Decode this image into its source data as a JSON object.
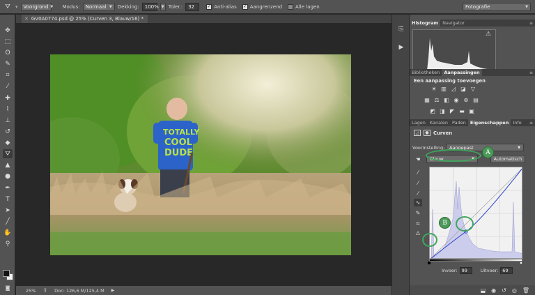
{
  "options_bar": {
    "fill_mode": "Voorgrond",
    "mode_label": "Modus:",
    "mode_value": "Normaal",
    "opacity_label": "Dekking:",
    "opacity_value": "100%",
    "tolerance_label": "Toler.:",
    "tolerance_value": "32",
    "antialias_label": "Anti-alias",
    "antialias_checked": true,
    "contiguous_label": "Aangrenzend",
    "contiguous_checked": true,
    "all_layers_label": "Alle lagen",
    "all_layers_checked": false,
    "workspace": "Fotografie"
  },
  "document": {
    "tab_title": "GV0A0774.psd @ 25% (Curven 3, Blauw/16) *",
    "zoom": "25%",
    "doc_info": "Doc: 126,6 M/125,4 M"
  },
  "panels": {
    "top_tabs": [
      "Histogram",
      "Navigator"
    ],
    "mid_tabs": [
      "Bibliotheken",
      "Aanpassingen"
    ],
    "add_adjustment": "Een aanpassing toevoegen",
    "props_tabs": [
      "Lagen",
      "Kanalen",
      "Paden",
      "Eigenschappen",
      "Info"
    ],
    "props_title": "Curven",
    "preset_label": "Voorinstelling:",
    "preset_value": "Aangepast",
    "channel_value": "Blauw",
    "auto_button": "Automatisch",
    "input_label": "Invoer:",
    "input_value": "99",
    "output_label": "Uitvoer:",
    "output_value": "69"
  },
  "annotations": {
    "a": "A",
    "b": "B"
  },
  "colors": {
    "annotation_green": "#4c9a5a",
    "ui_panel": "#535353",
    "canvas_bg": "#282828"
  }
}
